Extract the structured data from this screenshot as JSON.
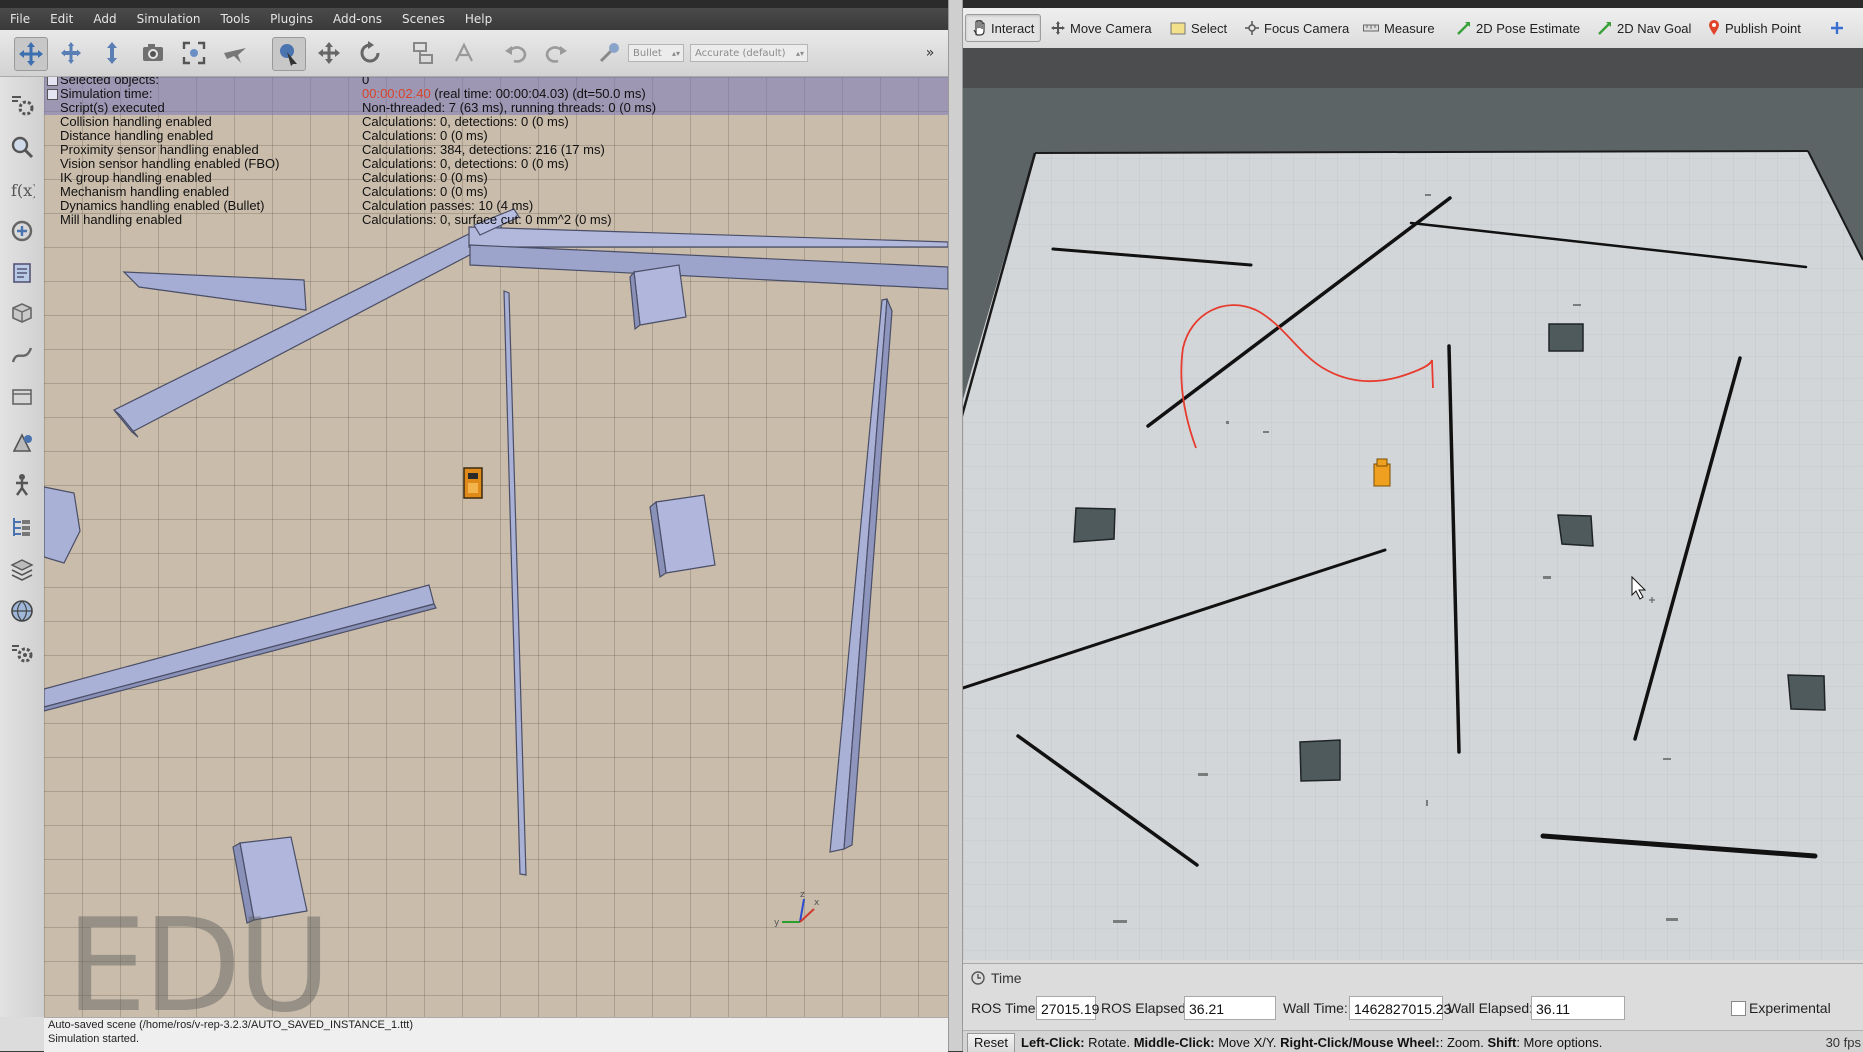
{
  "vrep": {
    "menu": [
      "File",
      "Edit",
      "Add",
      "Simulation",
      "Tools",
      "Plugins",
      "Add-ons",
      "Scenes",
      "Help"
    ],
    "toolbar": {
      "engine_label": "Bullet",
      "accuracy_label": "Accurate (default)"
    },
    "info": [
      {
        "key": "Selected objects:",
        "value": "0"
      },
      {
        "key": "Simulation time:",
        "value_prefix": "00:00:02.40",
        "value": " (real time: 00:00:04.03) (dt=50.0 ms)"
      },
      {
        "key": "Script(s) executed",
        "value": "Non-threaded: 7 (63 ms), running threads: 0 (0 ms)"
      },
      {
        "key": "Collision handling enabled",
        "value": "Calculations: 0, detections: 0 (0 ms)"
      },
      {
        "key": "Distance handling enabled",
        "value": "Calculations: 0 (0 ms)"
      },
      {
        "key": "Proximity sensor handling enabled",
        "value": "Calculations: 384, detections: 216 (17 ms)"
      },
      {
        "key": "Vision sensor handling enabled (FBO)",
        "value": "Calculations: 0, detections: 0 (0 ms)"
      },
      {
        "key": "IK group handling enabled",
        "value": "Calculations: 0 (0 ms)"
      },
      {
        "key": "Mechanism handling enabled",
        "value": "Calculations: 0 (0 ms)"
      },
      {
        "key": "Dynamics handling enabled (Bullet)",
        "value": "Calculation passes: 10 (4 ms)"
      },
      {
        "key": "Mill handling enabled",
        "value": "Calculations: 0, surface cut: 0 mm^2 (0 ms)"
      }
    ],
    "watermark": "EDU",
    "axis_labels": {
      "x": "x",
      "y": "y",
      "z": "z"
    },
    "status_lines": [
      "Auto-saved scene (/home/ros/v-rep-3.2.3/AUTO_SAVED_INSTANCE_1.ttt)",
      "Simulation started."
    ]
  },
  "rviz": {
    "tools": [
      {
        "label": "Interact",
        "icon": "hand-icon"
      },
      {
        "label": "Move Camera",
        "icon": "move-camera-icon"
      },
      {
        "label": "Select",
        "icon": "select-icon"
      },
      {
        "label": "Focus Camera",
        "icon": "focus-camera-icon"
      },
      {
        "label": "Measure",
        "icon": "measure-icon"
      },
      {
        "label": "2D Pose Estimate",
        "icon": "pose-estimate-icon"
      },
      {
        "label": "2D Nav Goal",
        "icon": "nav-goal-icon"
      },
      {
        "label": "Publish Point",
        "icon": "publish-point-icon"
      }
    ],
    "time_panel": {
      "title": "Time",
      "ros_time_label": "ROS Time:",
      "ros_time": "27015.19",
      "ros_elapsed_label": "ROS Elapsed:",
      "ros_elapsed": "36.21",
      "wall_time_label": "Wall Time:",
      "wall_time": "1462827015.23",
      "wall_elapsed_label": "Wall Elapsed:",
      "wall_elapsed": "36.11",
      "experimental_label": "Experimental"
    },
    "status": {
      "reset_label": "Reset",
      "help_1": "Left-Click:",
      "help_2": " Rotate. ",
      "help_3": "Middle-Click:",
      "help_4": " Move X/Y. ",
      "help_5": "Right-Click/Mouse Wheel:",
      "help_6": ": Zoom. ",
      "help_7": "Shift",
      "help_8": ": More options.",
      "fps": "30 fps"
    },
    "colors": {
      "path": "#e63b2e",
      "robot": "#f0a020"
    }
  }
}
